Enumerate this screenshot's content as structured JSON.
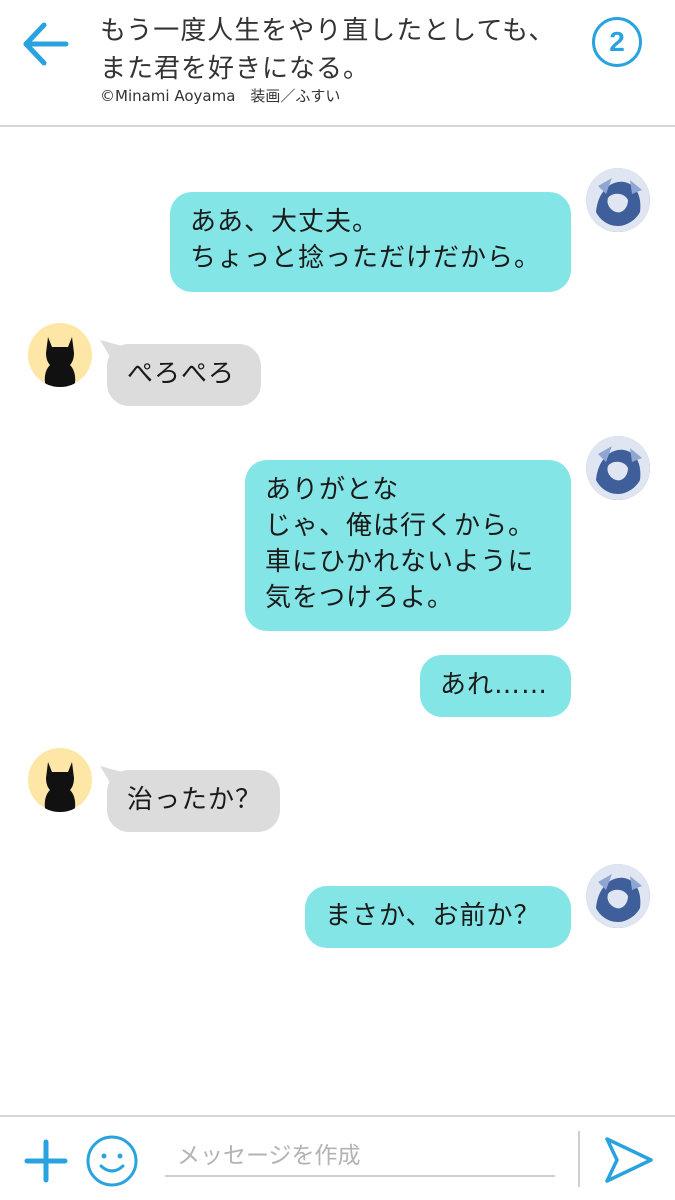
{
  "header": {
    "title_line1": "もう一度人生をやり直したとしても、",
    "title_line2": "また君を好きになる。",
    "credit": "©Minami Aoyama　装画／ふすい",
    "episode_number": "2"
  },
  "messages": [
    {
      "side": "right",
      "lines": [
        "ああ、大丈夫。",
        "ちょっと捻っただけだから。"
      ]
    },
    {
      "side": "left",
      "lines": [
        "ぺろぺろ"
      ]
    },
    {
      "side": "right",
      "lines": [
        "ありがとな",
        "じゃ、俺は行くから。",
        "車にひかれないように",
        "気をつけろよ。"
      ]
    },
    {
      "side": "right",
      "lines": [
        "あれ……"
      ]
    },
    {
      "side": "left",
      "lines": [
        "治ったか？"
      ]
    },
    {
      "side": "right",
      "lines": [
        "まさか、お前か？"
      ]
    }
  ],
  "input": {
    "placeholder": "メッセージを作成"
  },
  "colors": {
    "accent": "#29a3e0",
    "bubble_right": "#84e5e6",
    "bubble_left": "#dcdcdc",
    "cat_avatar_bg": "#fde6a6"
  },
  "icons": {
    "back": "arrow-left-icon",
    "add": "plus-icon",
    "emoji": "smiley-icon",
    "send": "send-icon"
  }
}
